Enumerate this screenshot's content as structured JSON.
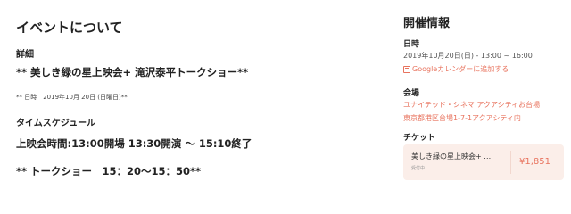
{
  "about": {
    "title": "イベントについて",
    "detail_label": "詳細",
    "headline": "** 美しき緑の星上映会+ 滝沢泰平トークショー**",
    "date_line": "** 日時　2019年10月 20日 (日曜日)**",
    "schedule_label": "タイムスケジュール",
    "schedule_main": "上映会時間:13:00開場 13:30開演 ～ 15:10終了",
    "schedule_talk": "** トークショー　15：20〜15：50**"
  },
  "info": {
    "title": "開催情報",
    "date_label": "日時",
    "date_value": "2019年10月20日(日) - 13:00 ~ 16:00",
    "gcal_link": "Googleカレンダーに追加する",
    "venue_label": "会場",
    "venue_name": "ユナイテッド・シネマ アクアシティお台場",
    "venue_address": "東京都港区台場1-7-1アクアシティ内",
    "ticket_label": "チケット",
    "ticket": {
      "name": "美しき緑の星上映会+ …",
      "status": "受付中",
      "price": "¥1,851"
    }
  },
  "colors": {
    "accent": "#e8735e",
    "ticket_bg": "#fbeee9"
  },
  "icons": {
    "gcal": "calendar-add-icon"
  }
}
